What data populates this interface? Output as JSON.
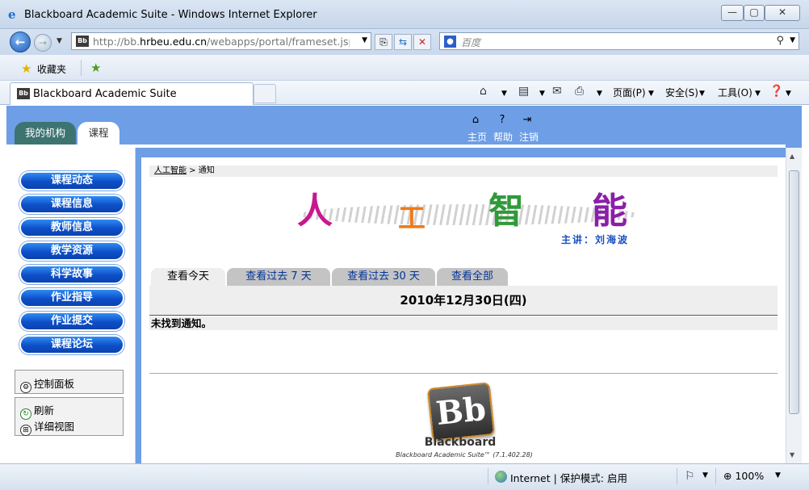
{
  "window": {
    "title": "Blackboard Academic Suite - Windows Internet Explorer",
    "min": "—",
    "max": "▢",
    "close": "✕"
  },
  "address": {
    "url_prefix": "http://bb.",
    "url_domain": "hrbeu.edu.cn",
    "url_suffix": "/webapps/portal/frameset.jsp?tab",
    "favicon": "Bb",
    "search_placeholder": "百度"
  },
  "favorites": {
    "label": "收藏夹"
  },
  "browser_tab": {
    "favicon": "Bb",
    "label": "Blackboard Academic Suite"
  },
  "commands": {
    "page": "页面(P)",
    "safety": "安全(S)",
    "tools": "工具(O)"
  },
  "portal_tabs": {
    "institution": "我的机构",
    "courses": "课程"
  },
  "top_nav": {
    "home": "主页",
    "help": "帮助",
    "logout": "注销"
  },
  "course_menu": [
    "课程动态",
    "课程信息",
    "教师信息",
    "教学资源",
    "科学故事",
    "作业指导",
    "作业提交",
    "课程论坛"
  ],
  "side_tools": {
    "control_panel": "控制面板",
    "refresh": "刷新",
    "detail_view": "详细视图"
  },
  "breadcrumb": {
    "course": "人工智能",
    "separator": " > ",
    "current": "通知"
  },
  "banner": {
    "chars": [
      "人",
      "工",
      "智",
      "能"
    ],
    "colors": [
      "#c8188c",
      "#f07a1a",
      "#2f9a3a",
      "#8a1fa8"
    ],
    "lecturer": "主讲：刘海波"
  },
  "view_tabs": [
    "查看今天",
    "查看过去 7 天",
    "查看过去 30 天",
    "查看全部"
  ],
  "announcements": {
    "date": "2010年12月30日(四)",
    "empty_message": "未找到通知。"
  },
  "footer": {
    "logo_letters": "Bb",
    "brand": "Blackboard",
    "version": "Blackboard Academic Suite™ (7.1.402.28)"
  },
  "status": {
    "zone": "Internet | 保护模式: 启用",
    "zoom": "100%"
  }
}
